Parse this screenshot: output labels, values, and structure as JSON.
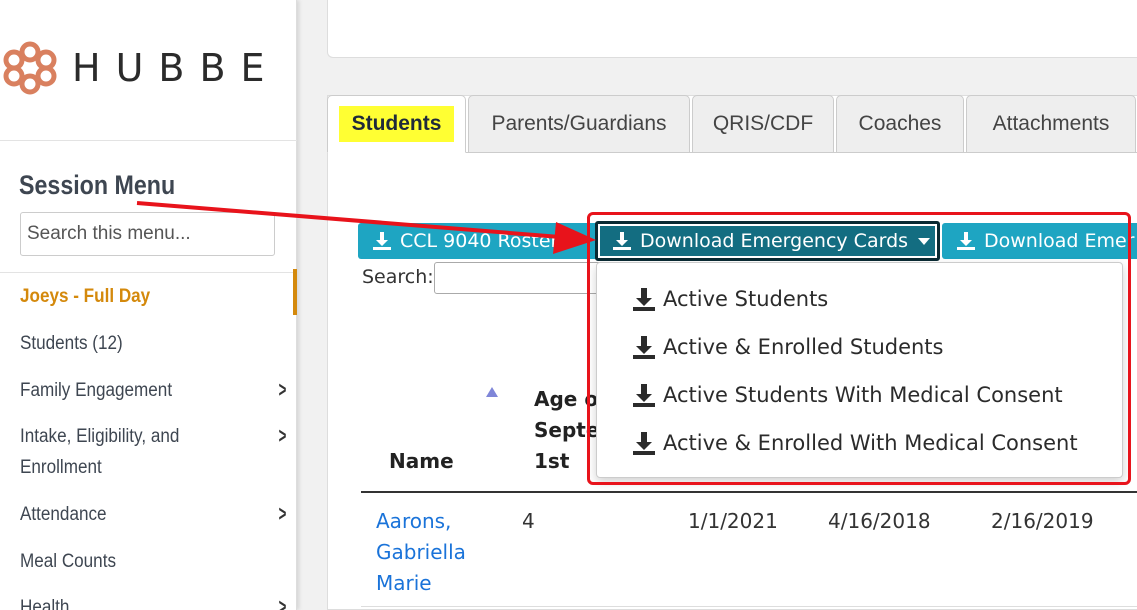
{
  "brand": {
    "logo_text": "HUBBE"
  },
  "sidebar": {
    "title": "Session Menu",
    "search_placeholder": "Search this menu...",
    "items": [
      {
        "label": "Joeys - Full Day",
        "active": true
      },
      {
        "label": "Students (12)"
      },
      {
        "label": "Family Engagement",
        "has_children": true
      },
      {
        "label": "Intake, Eligibility, and",
        "label_line2": "Enrollment",
        "has_children": true
      },
      {
        "label": "Attendance",
        "has_children": true
      },
      {
        "label": "Meal Counts"
      },
      {
        "label": "Health",
        "has_children": true
      }
    ]
  },
  "tabs": [
    {
      "label": "Students",
      "active": true
    },
    {
      "label": "Parents/Guardians"
    },
    {
      "label": "QRIS/CDF"
    },
    {
      "label": "Coaches"
    },
    {
      "label": "Attachments"
    }
  ],
  "toolbar": {
    "ccl_label": "CCL 9040 Roster",
    "emergency_label": "Download Emergency Cards",
    "third_label": "Download Emer"
  },
  "dropdown": {
    "items": [
      "Active Students",
      "Active & Enrolled Students",
      "Active Students With Medical Consent",
      "Active & Enrolled With Medical Consent"
    ]
  },
  "search": {
    "label": "Search:"
  },
  "table": {
    "headers": {
      "name": "Name",
      "age_line1": "Age o",
      "age_line2": "Septe",
      "age_line3": "1st"
    },
    "rows": [
      {
        "name_line1": "Aarons,",
        "name_line2": "Gabriella",
        "name_line3": "Marie",
        "age": "4",
        "date1": "1/1/2021",
        "date2": "4/16/2018",
        "date3": "2/16/2019"
      }
    ]
  },
  "colors": {
    "accent": "#1ea5c2",
    "accent_dark": "#136d81",
    "active_menu": "#d4890c",
    "highlight": "#ffff33",
    "annotation": "#e8131b",
    "link": "#1a73d9"
  }
}
